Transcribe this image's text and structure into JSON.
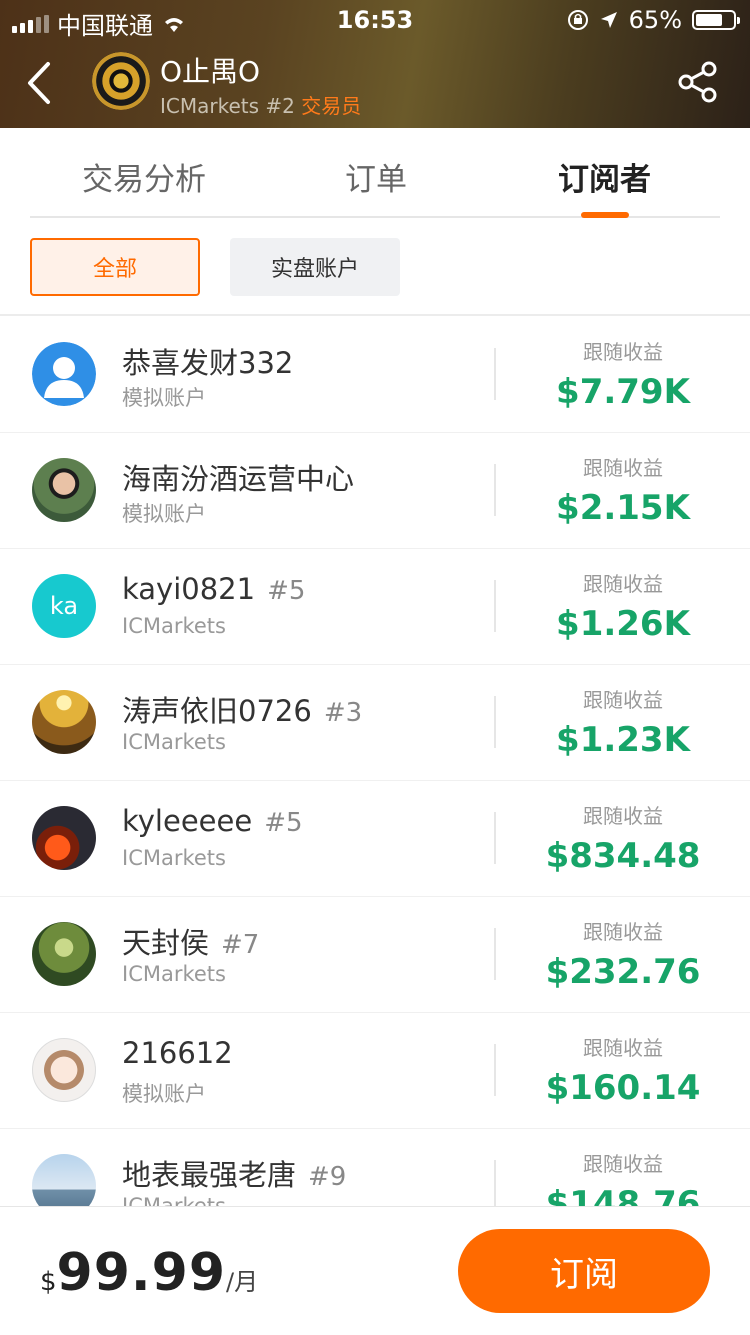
{
  "status_bar": {
    "carrier": "中国联通",
    "time": "16:53",
    "battery": "65%"
  },
  "header": {
    "trader_name": "O止禺O",
    "broker": "ICMarkets",
    "rank": "#2",
    "role": "交易员"
  },
  "tabs": [
    {
      "label": "交易分析"
    },
    {
      "label": "订单"
    },
    {
      "label": "订阅者"
    }
  ],
  "filters": [
    {
      "label": "全部"
    },
    {
      "label": "实盘账户"
    }
  ],
  "subscribers": [
    {
      "name": "恭喜发财332",
      "rank": "",
      "account": "模拟账户",
      "pl_label": "跟随收益",
      "pl": "$7.79K"
    },
    {
      "name": "海南汾酒运营中心",
      "rank": "",
      "account": "模拟账户",
      "pl_label": "跟随收益",
      "pl": "$2.15K"
    },
    {
      "name": "kayi0821",
      "rank": "#5",
      "account": "ICMarkets",
      "pl_label": "跟随收益",
      "pl": "$1.26K",
      "avatar_text": "ka"
    },
    {
      "name": "涛声依旧0726",
      "rank": "#3",
      "account": "ICMarkets",
      "pl_label": "跟随收益",
      "pl": "$1.23K"
    },
    {
      "name": "kyleeeee",
      "rank": "#5",
      "account": "ICMarkets",
      "pl_label": "跟随收益",
      "pl": "$834.48"
    },
    {
      "name": "天封侯",
      "rank": "#7",
      "account": "ICMarkets",
      "pl_label": "跟随收益",
      "pl": "$232.76"
    },
    {
      "name": "216612",
      "rank": "",
      "account": "模拟账户",
      "pl_label": "跟随收益",
      "pl": "$160.14"
    },
    {
      "name": "地表最强老唐",
      "rank": "#9",
      "account": "ICMarkets",
      "pl_label": "跟随收益",
      "pl": "$148.76"
    }
  ],
  "footer": {
    "currency": "$",
    "price": "99.99",
    "unit": "/月",
    "subscribe_label": "订阅"
  },
  "colors": {
    "accent": "#ff6a00",
    "profit": "#17a468"
  }
}
